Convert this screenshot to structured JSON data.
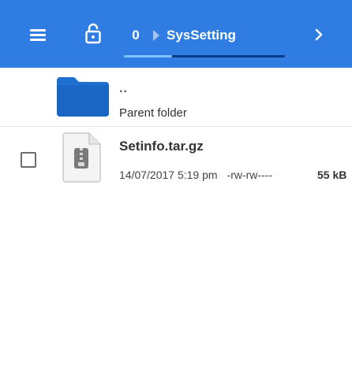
{
  "toolbar": {
    "breadcrumb_root": "0",
    "breadcrumb_current": "SysSetting",
    "icons": {
      "menu": "hamburger-menu-icon",
      "lock": "unlock-icon",
      "next": "chevron-right-icon"
    },
    "load_progress": 0.3,
    "colors": {
      "bar": "#2f7de3",
      "progress_track": "#0d3c86",
      "progress_fill": "#7fc3ff"
    }
  },
  "list": {
    "parent": {
      "name": "..",
      "label": "Parent folder",
      "icon": "folder-icon",
      "icon_color": "#1e6fcf"
    },
    "files": [
      {
        "name": "Setinfo.tar.gz",
        "date": "14/07/2017 5:19 pm",
        "permissions": "-rw-rw----",
        "size": "55 kB",
        "icon": "archive-file-icon",
        "checked": false
      }
    ]
  }
}
